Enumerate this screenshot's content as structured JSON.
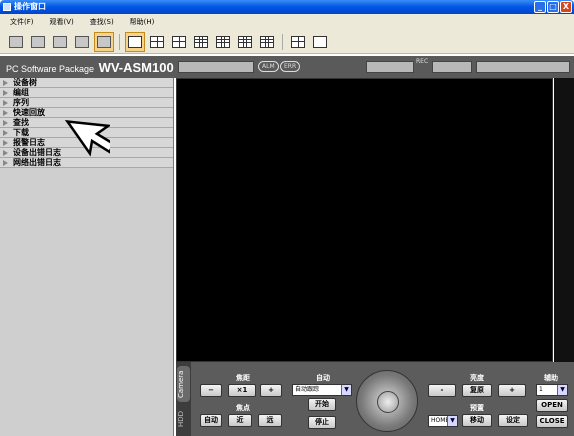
{
  "window": {
    "title": "操作窗口",
    "min": "_",
    "max": "□",
    "close": "X"
  },
  "menu": [
    "文件(F)",
    "观看(V)",
    "查找(S)",
    "帮助(H)"
  ],
  "product": {
    "prefix": "PC Software Package",
    "model": "WV-ASM100",
    "alm": "ALM",
    "err": "ERR",
    "rec": "REC"
  },
  "nav": {
    "items": [
      "设备树",
      "编组",
      "序列",
      "快速回放",
      "查找",
      "下载",
      "报警日志",
      "设备出错日志",
      "网络出错日志"
    ]
  },
  "panel": {
    "tabs": {
      "camera": "Camera",
      "hdd": "HDD"
    },
    "zoom": {
      "label": "焦距",
      "x1": "×1"
    },
    "focus": {
      "label": "焦点",
      "auto": "自动",
      "near": "近",
      "far": "远"
    },
    "auto": {
      "label": "自动",
      "select": "自动跟踪",
      "start": "开始",
      "stop": "停止"
    },
    "brightness": {
      "label": "亮度",
      "minus": "-",
      "reset": "复原",
      "plus": "+"
    },
    "preset": {
      "label": "预置",
      "select": "HOME",
      "move": "移动",
      "set": "设定"
    },
    "aux": {
      "label": "辅助",
      "select": "1",
      "open": "OPEN",
      "close": "CLOSE"
    }
  },
  "icons": {
    "arrow": "▼",
    "zoom_out": "−",
    "zoom_in": "+"
  }
}
